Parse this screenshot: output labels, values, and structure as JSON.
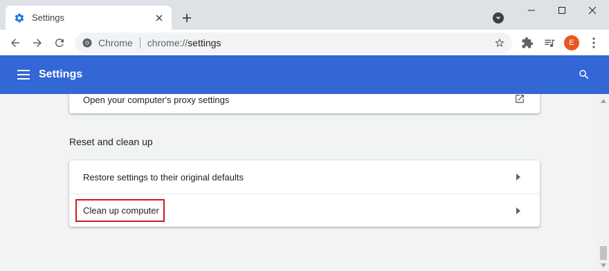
{
  "tab": {
    "title": "Settings",
    "favicon": "gear-icon"
  },
  "omnibox": {
    "site_chip": "Chrome",
    "url_scheme": "chrome://",
    "url_host": "settings"
  },
  "profile": {
    "initial": "E",
    "color": "#e8571d"
  },
  "header": {
    "title": "Settings",
    "color": "#3367d6"
  },
  "proxy_card": {
    "label": "Open your computer's proxy settings",
    "icon": "open-in-new-icon"
  },
  "reset_section": {
    "title": "Reset and clean up",
    "items": [
      {
        "label": "Restore settings to their original defaults",
        "icon": "arrow-right-icon"
      },
      {
        "label": "Clean up computer",
        "icon": "arrow-right-icon",
        "highlighted": true
      }
    ]
  },
  "colors": {
    "highlight": "#cc1b1b",
    "background": "#f1f3f4"
  }
}
